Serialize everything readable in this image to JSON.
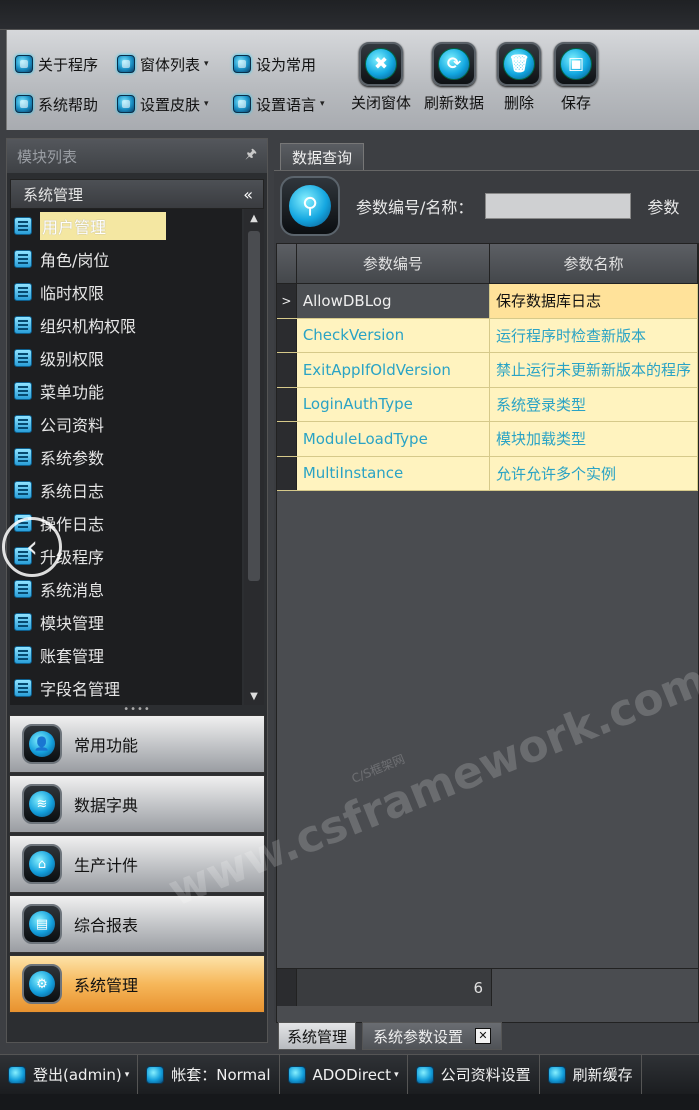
{
  "ribbon": {
    "small_buttons": [
      {
        "label": "关于程序",
        "icon": "info-icon",
        "dropdown": false
      },
      {
        "label": "窗体列表",
        "icon": "window-list-icon",
        "dropdown": true
      },
      {
        "label": "设为常用",
        "icon": "star-icon",
        "dropdown": false
      },
      {
        "label": "系统帮助",
        "icon": "help-icon",
        "dropdown": false
      },
      {
        "label": "设置皮肤",
        "icon": "skin-icon",
        "dropdown": true
      },
      {
        "label": "设置语言",
        "icon": "language-icon",
        "dropdown": true
      }
    ],
    "big_buttons": [
      {
        "label": "关闭窗体",
        "icon": "close-window-icon",
        "glyph": "✖"
      },
      {
        "label": "刷新数据",
        "icon": "refresh-icon",
        "glyph": "⟳"
      },
      {
        "label": "删除",
        "icon": "trash-icon",
        "glyph": "🗑"
      },
      {
        "label": "保存",
        "icon": "save-icon",
        "glyph": "▣"
      }
    ]
  },
  "left_panel": {
    "title": "模块列表",
    "pin_glyph": "🖈",
    "group": "系统管理",
    "collapse_glyph": "«",
    "items": [
      "用户管理",
      "角色/岗位",
      "临时权限",
      "组织机构权限",
      "级别权限",
      "菜单功能",
      "公司资料",
      "系统参数",
      "系统日志",
      "操作日志",
      "升级程序",
      "系统消息",
      "模块管理",
      "账套管理",
      "字段名管理"
    ],
    "selected_index": 0,
    "nav_buttons": [
      {
        "label": "常用功能",
        "icon": "user-icon",
        "glyph": "👤"
      },
      {
        "label": "数据字典",
        "icon": "database-icon",
        "glyph": "≋"
      },
      {
        "label": "生产计件",
        "icon": "home-icon",
        "glyph": "⌂"
      },
      {
        "label": "综合报表",
        "icon": "report-icon",
        "glyph": "▤"
      },
      {
        "label": "系统管理",
        "icon": "gear-icon",
        "glyph": "⚙"
      }
    ],
    "active_nav_index": 4
  },
  "main": {
    "tab": "数据查询",
    "query": {
      "label": "参数编号/名称：",
      "value": "",
      "label2": "参数"
    },
    "grid": {
      "columns": [
        "参数编号",
        "参数名称"
      ],
      "rows": [
        {
          "code": "AllowDBLog",
          "name": "保存数据库日志"
        },
        {
          "code": "CheckVersion",
          "name": "运行程序时检查新版本"
        },
        {
          "code": "ExitAppIfOldVersion",
          "name": "禁止运行未更新新版本的程序"
        },
        {
          "code": "LoginAuthType",
          "name": "系统登录类型"
        },
        {
          "code": "ModuleLoadType",
          "name": "模块加载类型"
        },
        {
          "code": "MultiInstance",
          "name": "允许允许多个实例"
        }
      ],
      "current_row": 0,
      "current_marker": ">",
      "footer_count": "6"
    }
  },
  "bottom_tabs": [
    {
      "label": "系统管理"
    },
    {
      "label": "系统参数设置",
      "close_glyph": "✕"
    }
  ],
  "status_bar": [
    {
      "label": "登出(admin)",
      "icon": "logout-icon",
      "dropdown": true
    },
    {
      "label": "帐套：Normal",
      "icon": "account-icon",
      "dropdown": false
    },
    {
      "label": "ADODirect",
      "icon": "lightning-icon",
      "dropdown": true
    },
    {
      "label": "公司资料设置",
      "icon": "company-icon",
      "dropdown": false
    },
    {
      "label": "刷新缓存",
      "icon": "refresh-cache-icon",
      "dropdown": false
    }
  ],
  "overlay": {
    "back_glyph": "‹",
    "watermark": "www.csframework.com",
    "watermark_sub": "C/S框架网"
  },
  "colors": {
    "accent": "#139fdc",
    "selected_row": "#ffe29a",
    "row_bg": "#fff3bf",
    "active_nav": "#f6b75a"
  }
}
